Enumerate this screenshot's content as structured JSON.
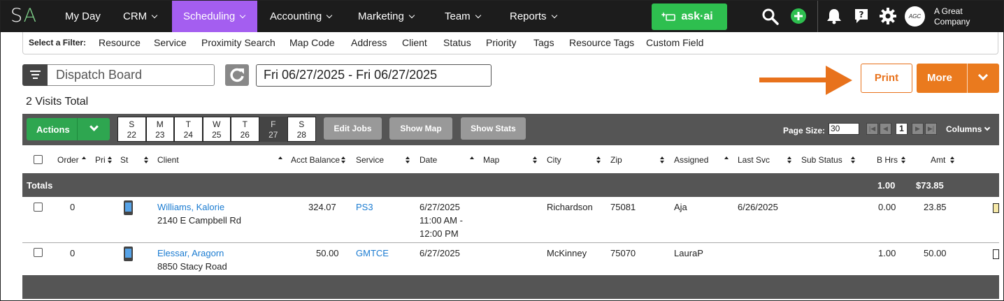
{
  "nav": {
    "logo_s": "S",
    "logo_a": "A",
    "items": [
      {
        "label": "My Day"
      },
      {
        "label": "CRM"
      },
      {
        "label": "Scheduling"
      },
      {
        "label": "Accounting"
      },
      {
        "label": "Marketing"
      },
      {
        "label": "Team"
      },
      {
        "label": "Reports"
      }
    ],
    "askai": "ask·ai",
    "company": "A Great Company",
    "avatar_text": "AGC",
    "icons": [
      "search-icon",
      "add-icon",
      "bell-icon",
      "help-icon",
      "gear-icon"
    ],
    "accent": "#a45ef0"
  },
  "filter": {
    "label": "Select a Filter:",
    "items": [
      "Resource",
      "Service",
      "Proximity Search",
      "Map Code",
      "Address",
      "Client",
      "Status",
      "Priority",
      "Tags",
      "Resource Tags",
      "Custom Field"
    ]
  },
  "board": {
    "name": "Dispatch Board",
    "date_range": "Fri 06/27/2025 - Fri 06/27/2025",
    "print": "Print",
    "more": "More",
    "visits_total": "2 Visits Total"
  },
  "toolbar": {
    "actions": "Actions",
    "days": [
      {
        "d": "S",
        "n": "22"
      },
      {
        "d": "M",
        "n": "23"
      },
      {
        "d": "T",
        "n": "24"
      },
      {
        "d": "W",
        "n": "25"
      },
      {
        "d": "T",
        "n": "26"
      },
      {
        "d": "F",
        "n": "27"
      },
      {
        "d": "S",
        "n": "28"
      }
    ],
    "edit_jobs": "Edit Jobs",
    "show_map": "Show Map",
    "show_stats": "Show Stats",
    "page_size_label": "Page Size:",
    "page_size": "30",
    "current_page": "1",
    "columns": "Columns"
  },
  "table": {
    "headers": [
      "Order",
      "Pri",
      "St",
      "Client",
      "Acct Balance",
      "Service",
      "Date",
      "Map",
      "City",
      "Zip",
      "Assigned",
      "Last Svc",
      "Sub Status",
      "B Hrs",
      "Amt"
    ],
    "totals": {
      "label": "Totals",
      "bhrs": "1.00",
      "amt": "$73.85"
    },
    "rows": [
      {
        "order": "0",
        "client": "Williams, Kalorie",
        "address": "2140 E Campbell Rd",
        "balance": "324.07",
        "service": "PS3",
        "date": "6/27/2025",
        "time1": "11:00 AM -",
        "time2": "12:00 PM",
        "city": "Richardson",
        "zip": "75081",
        "assigned": "Aja",
        "last_svc": "6/26/2025",
        "bhrs": "0.00",
        "amt": "23.85"
      },
      {
        "order": "0",
        "client": "Elessar, Aragorn",
        "address": "8850 Stacy Road",
        "balance": "50.00",
        "service": "GMTCE",
        "date": "6/27/2025",
        "time1": "",
        "time2": "",
        "city": "McKinney",
        "zip": "75070",
        "assigned": "LauraP",
        "last_svc": "",
        "bhrs": "1.00",
        "amt": "50.00"
      }
    ]
  }
}
